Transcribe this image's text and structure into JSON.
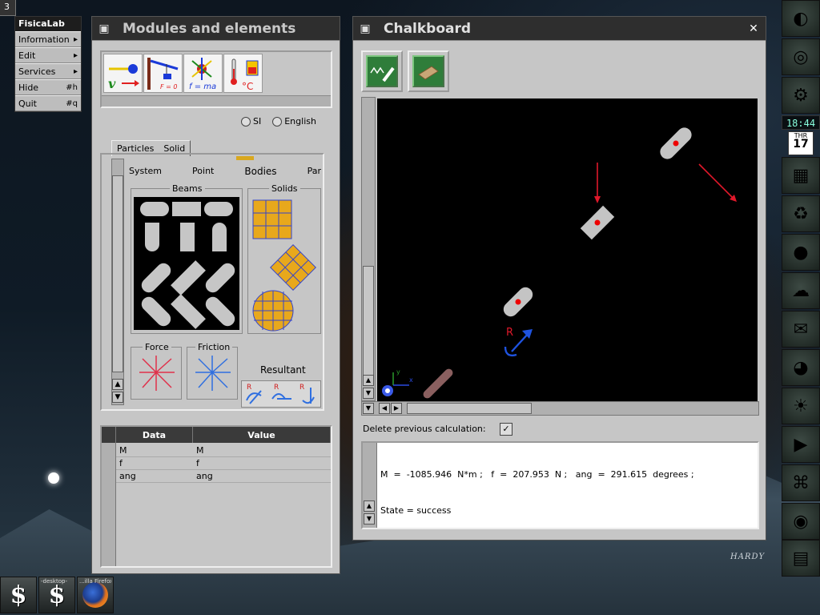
{
  "menu": {
    "workspace_badge": "3",
    "title": "FisicaLab",
    "items": [
      {
        "label": "Information",
        "key": "▸"
      },
      {
        "label": "Edit",
        "key": "▸"
      },
      {
        "label": "Services",
        "key": "▸"
      },
      {
        "label": "Hide",
        "key": "#h"
      },
      {
        "label": "Quit",
        "key": "#q"
      }
    ]
  },
  "modules": {
    "title": "Modules and elements",
    "icons": [
      "kinematics-icon",
      "statics-icon",
      "dynamics-icon",
      "heat-icon"
    ],
    "icon_labels": {
      "statics": "F = 0",
      "dynamics": "f = ma",
      "heat": "°C"
    },
    "units": {
      "si": "SI",
      "english": "English"
    },
    "tabs": {
      "particles": "Particles",
      "solid": "Solid"
    },
    "subtabs": {
      "system": "System",
      "point": "Point",
      "bodies": "Bodies",
      "par": "Par"
    },
    "groups": {
      "beams": "Beams",
      "solids": "Solids",
      "force": "Force",
      "friction": "Friction",
      "resultant": "Resultant"
    },
    "resultant_marks": [
      "R",
      "R",
      "R"
    ],
    "table": {
      "headers": [
        "Data",
        "Value"
      ],
      "rows": [
        {
          "data": "M",
          "value": "M"
        },
        {
          "data": "f",
          "value": "f"
        },
        {
          "data": "ang",
          "value": "ang"
        }
      ]
    }
  },
  "chalkboard": {
    "title": "Chalkboard",
    "close": "✕",
    "tools": [
      "chalk-tool-icon",
      "eraser-tool-icon"
    ],
    "delete_label": "Delete previous calculation:",
    "delete_checked": "✓",
    "axis_x": "x",
    "axis_y": "y",
    "resultant_label": "R",
    "output_line1": "M  =  -1085.946  N*m ;   f  =  207.953  N ;   ang  =  291.615  degrees ;",
    "output_line2": "State = success"
  },
  "dock": {
    "clock": "18:44",
    "cal_day": "THR",
    "cal_date": "17"
  },
  "taskbar": [
    {
      "caption": "",
      "icon": "gnustep-dollar-icon"
    },
    {
      "caption": "-desktop-",
      "icon": "gnustep-dollar-icon"
    },
    {
      "caption": "...illa Firefox",
      "icon": "firefox-icon"
    }
  ],
  "watermark": "HARDY"
}
